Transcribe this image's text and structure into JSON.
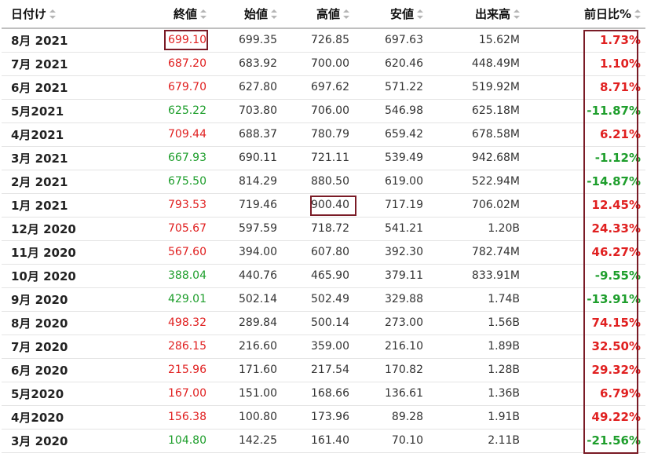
{
  "columns": [
    {
      "key": "date",
      "label": "日付け"
    },
    {
      "key": "close",
      "label": "終値"
    },
    {
      "key": "open",
      "label": "始値"
    },
    {
      "key": "high",
      "label": "高値"
    },
    {
      "key": "low",
      "label": "安値"
    },
    {
      "key": "volume",
      "label": "出来高"
    },
    {
      "key": "change",
      "label": "前日比%"
    }
  ],
  "rows": [
    {
      "date": "8月 2021",
      "close": "699.10",
      "open": "699.35",
      "high": "726.85",
      "low": "697.63",
      "volume": "15.62M",
      "change": "1.73%",
      "dir": "up"
    },
    {
      "date": "7月 2021",
      "close": "687.20",
      "open": "683.92",
      "high": "700.00",
      "low": "620.46",
      "volume": "448.49M",
      "change": "1.10%",
      "dir": "up"
    },
    {
      "date": "6月 2021",
      "close": "679.70",
      "open": "627.80",
      "high": "697.62",
      "low": "571.22",
      "volume": "519.92M",
      "change": "8.71%",
      "dir": "up"
    },
    {
      "date": "5月2021",
      "close": "625.22",
      "open": "703.80",
      "high": "706.00",
      "low": "546.98",
      "volume": "625.18M",
      "change": "-11.87%",
      "dir": "down"
    },
    {
      "date": "4月2021",
      "close": "709.44",
      "open": "688.37",
      "high": "780.79",
      "low": "659.42",
      "volume": "678.58M",
      "change": "6.21%",
      "dir": "up"
    },
    {
      "date": "3月 2021",
      "close": "667.93",
      "open": "690.11",
      "high": "721.11",
      "low": "539.49",
      "volume": "942.68M",
      "change": "-1.12%",
      "dir": "down"
    },
    {
      "date": "2月 2021",
      "close": "675.50",
      "open": "814.29",
      "high": "880.50",
      "low": "619.00",
      "volume": "522.94M",
      "change": "-14.87%",
      "dir": "down"
    },
    {
      "date": "1月 2021",
      "close": "793.53",
      "open": "719.46",
      "high": "900.40",
      "low": "717.19",
      "volume": "706.02M",
      "change": "12.45%",
      "dir": "up"
    },
    {
      "date": "12月 2020",
      "close": "705.67",
      "open": "597.59",
      "high": "718.72",
      "low": "541.21",
      "volume": "1.20B",
      "change": "24.33%",
      "dir": "up"
    },
    {
      "date": "11月 2020",
      "close": "567.60",
      "open": "394.00",
      "high": "607.80",
      "low": "392.30",
      "volume": "782.74M",
      "change": "46.27%",
      "dir": "up"
    },
    {
      "date": "10月 2020",
      "close": "388.04",
      "open": "440.76",
      "high": "465.90",
      "low": "379.11",
      "volume": "833.91M",
      "change": "-9.55%",
      "dir": "down"
    },
    {
      "date": "9月 2020",
      "close": "429.01",
      "open": "502.14",
      "high": "502.49",
      "low": "329.88",
      "volume": "1.74B",
      "change": "-13.91%",
      "dir": "down"
    },
    {
      "date": "8月 2020",
      "close": "498.32",
      "open": "289.84",
      "high": "500.14",
      "low": "273.00",
      "volume": "1.56B",
      "change": "74.15%",
      "dir": "up"
    },
    {
      "date": "7月 2020",
      "close": "286.15",
      "open": "216.60",
      "high": "359.00",
      "low": "216.10",
      "volume": "1.89B",
      "change": "32.50%",
      "dir": "up"
    },
    {
      "date": "6月 2020",
      "close": "215.96",
      "open": "171.60",
      "high": "217.54",
      "low": "170.82",
      "volume": "1.28B",
      "change": "29.32%",
      "dir": "up"
    },
    {
      "date": "5月2020",
      "close": "167.00",
      "open": "151.00",
      "high": "168.66",
      "low": "136.61",
      "volume": "1.36B",
      "change": "6.79%",
      "dir": "up"
    },
    {
      "date": "4月2020",
      "close": "156.38",
      "open": "100.80",
      "high": "173.96",
      "low": "89.28",
      "volume": "1.91B",
      "change": "49.22%",
      "dir": "up"
    },
    {
      "date": "3月 2020",
      "close": "104.80",
      "open": "142.25",
      "high": "161.40",
      "low": "70.10",
      "volume": "2.11B",
      "change": "-21.56%",
      "dir": "down"
    }
  ],
  "colors": {
    "up": "#e02020",
    "down": "#1e9e2c",
    "highlight_border": "#7a1b26"
  }
}
